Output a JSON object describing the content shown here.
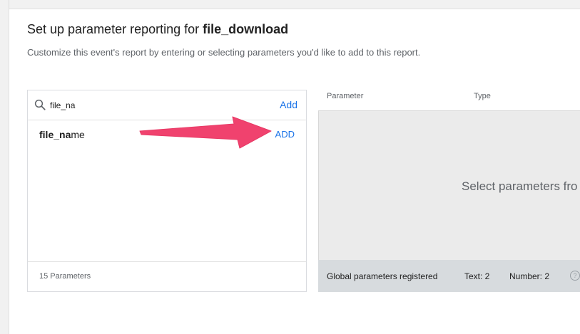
{
  "dialog": {
    "title_prefix": "Set up parameter reporting for ",
    "title_event": "file_download",
    "subtitle": "Customize this event's report by entering or selecting parameters you'd like to add to this report."
  },
  "search": {
    "value": "file_na",
    "add_label": "Add"
  },
  "results": [
    {
      "match": "file_na",
      "rest": "me",
      "add_label": "ADD"
    }
  ],
  "left_footer": {
    "count_text": "15 Parameters"
  },
  "table": {
    "columns": [
      "Parameter",
      "Type"
    ],
    "empty_message": "Select parameters fro"
  },
  "global_bar": {
    "label": "Global parameters registered",
    "text_count": "Text: 2",
    "number_count": "Number: 2",
    "help_glyph": "?"
  },
  "colors": {
    "accent": "#1a73e8",
    "arrow": "#f0426e"
  },
  "icons": {
    "search": "search-icon",
    "help": "help-icon",
    "annotation": "arrow-annotation"
  }
}
